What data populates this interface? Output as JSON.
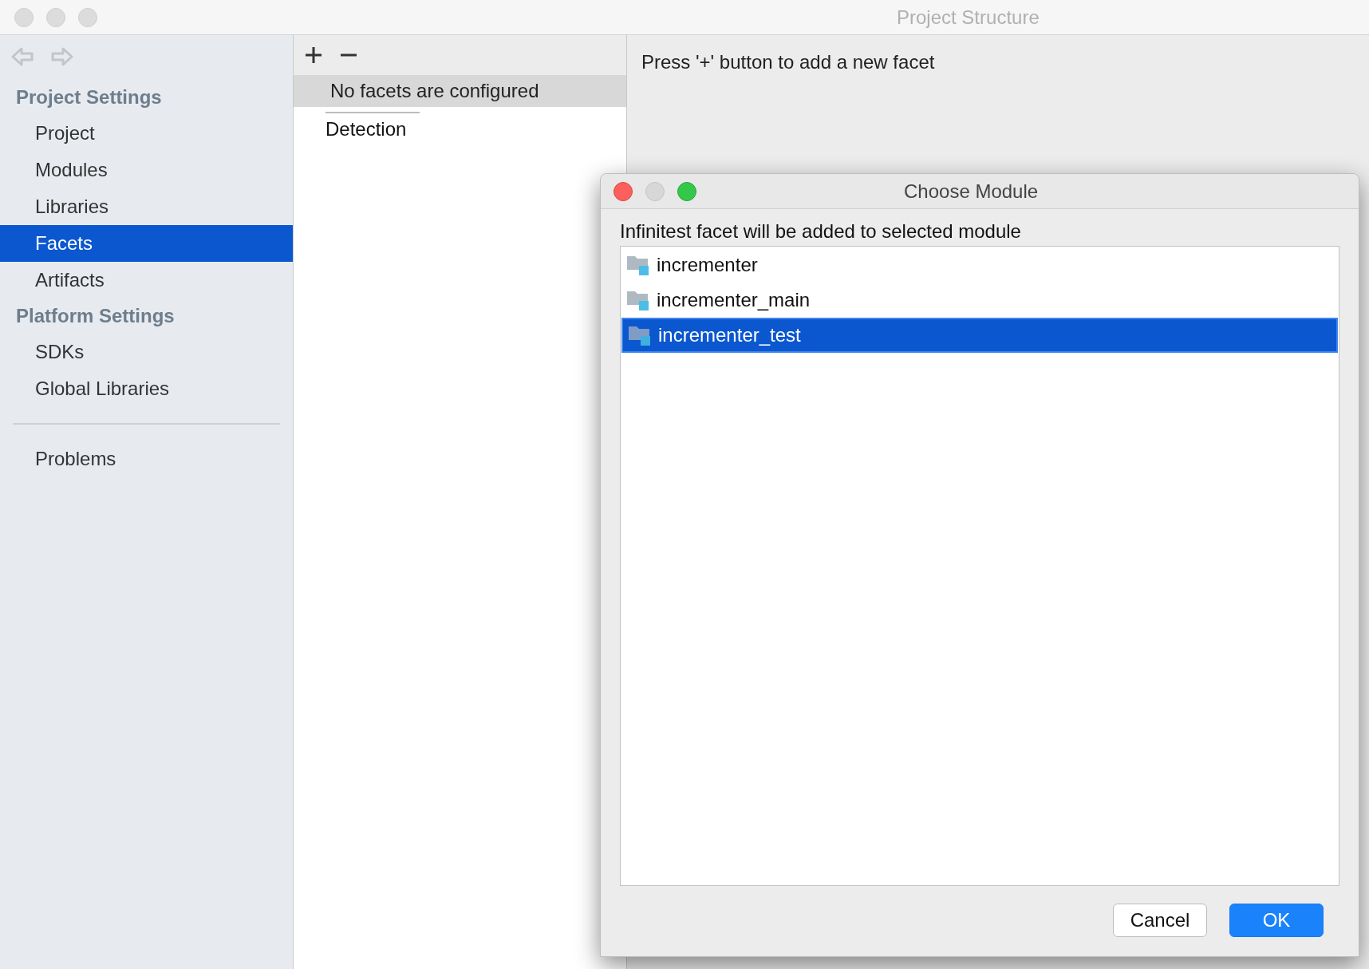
{
  "window": {
    "title": "Project Structure"
  },
  "sidebar": {
    "groups": [
      {
        "title": "Project Settings",
        "items": [
          {
            "label": "Project",
            "selected": false
          },
          {
            "label": "Modules",
            "selected": false
          },
          {
            "label": "Libraries",
            "selected": false
          },
          {
            "label": "Facets",
            "selected": true
          },
          {
            "label": "Artifacts",
            "selected": false
          }
        ]
      },
      {
        "title": "Platform Settings",
        "items": [
          {
            "label": "SDKs",
            "selected": false
          },
          {
            "label": "Global Libraries",
            "selected": false
          }
        ]
      }
    ],
    "footer_items": [
      {
        "label": "Problems",
        "selected": false
      }
    ]
  },
  "facets_panel": {
    "empty_message": "No facets are configured",
    "items": [
      {
        "label": "Detection",
        "selected": false
      }
    ]
  },
  "details_panel": {
    "hint": "Press '+' button to add a new facet"
  },
  "dialog": {
    "title": "Choose Module",
    "prompt": "Infinitest facet will be added to selected module",
    "modules": [
      {
        "label": "incrementer",
        "selected": false
      },
      {
        "label": "incrementer_main",
        "selected": false
      },
      {
        "label": "incrementer_test",
        "selected": true
      }
    ],
    "buttons": [
      {
        "label": "Cancel",
        "kind": "secondary"
      },
      {
        "label": "OK",
        "kind": "primary"
      }
    ]
  }
}
